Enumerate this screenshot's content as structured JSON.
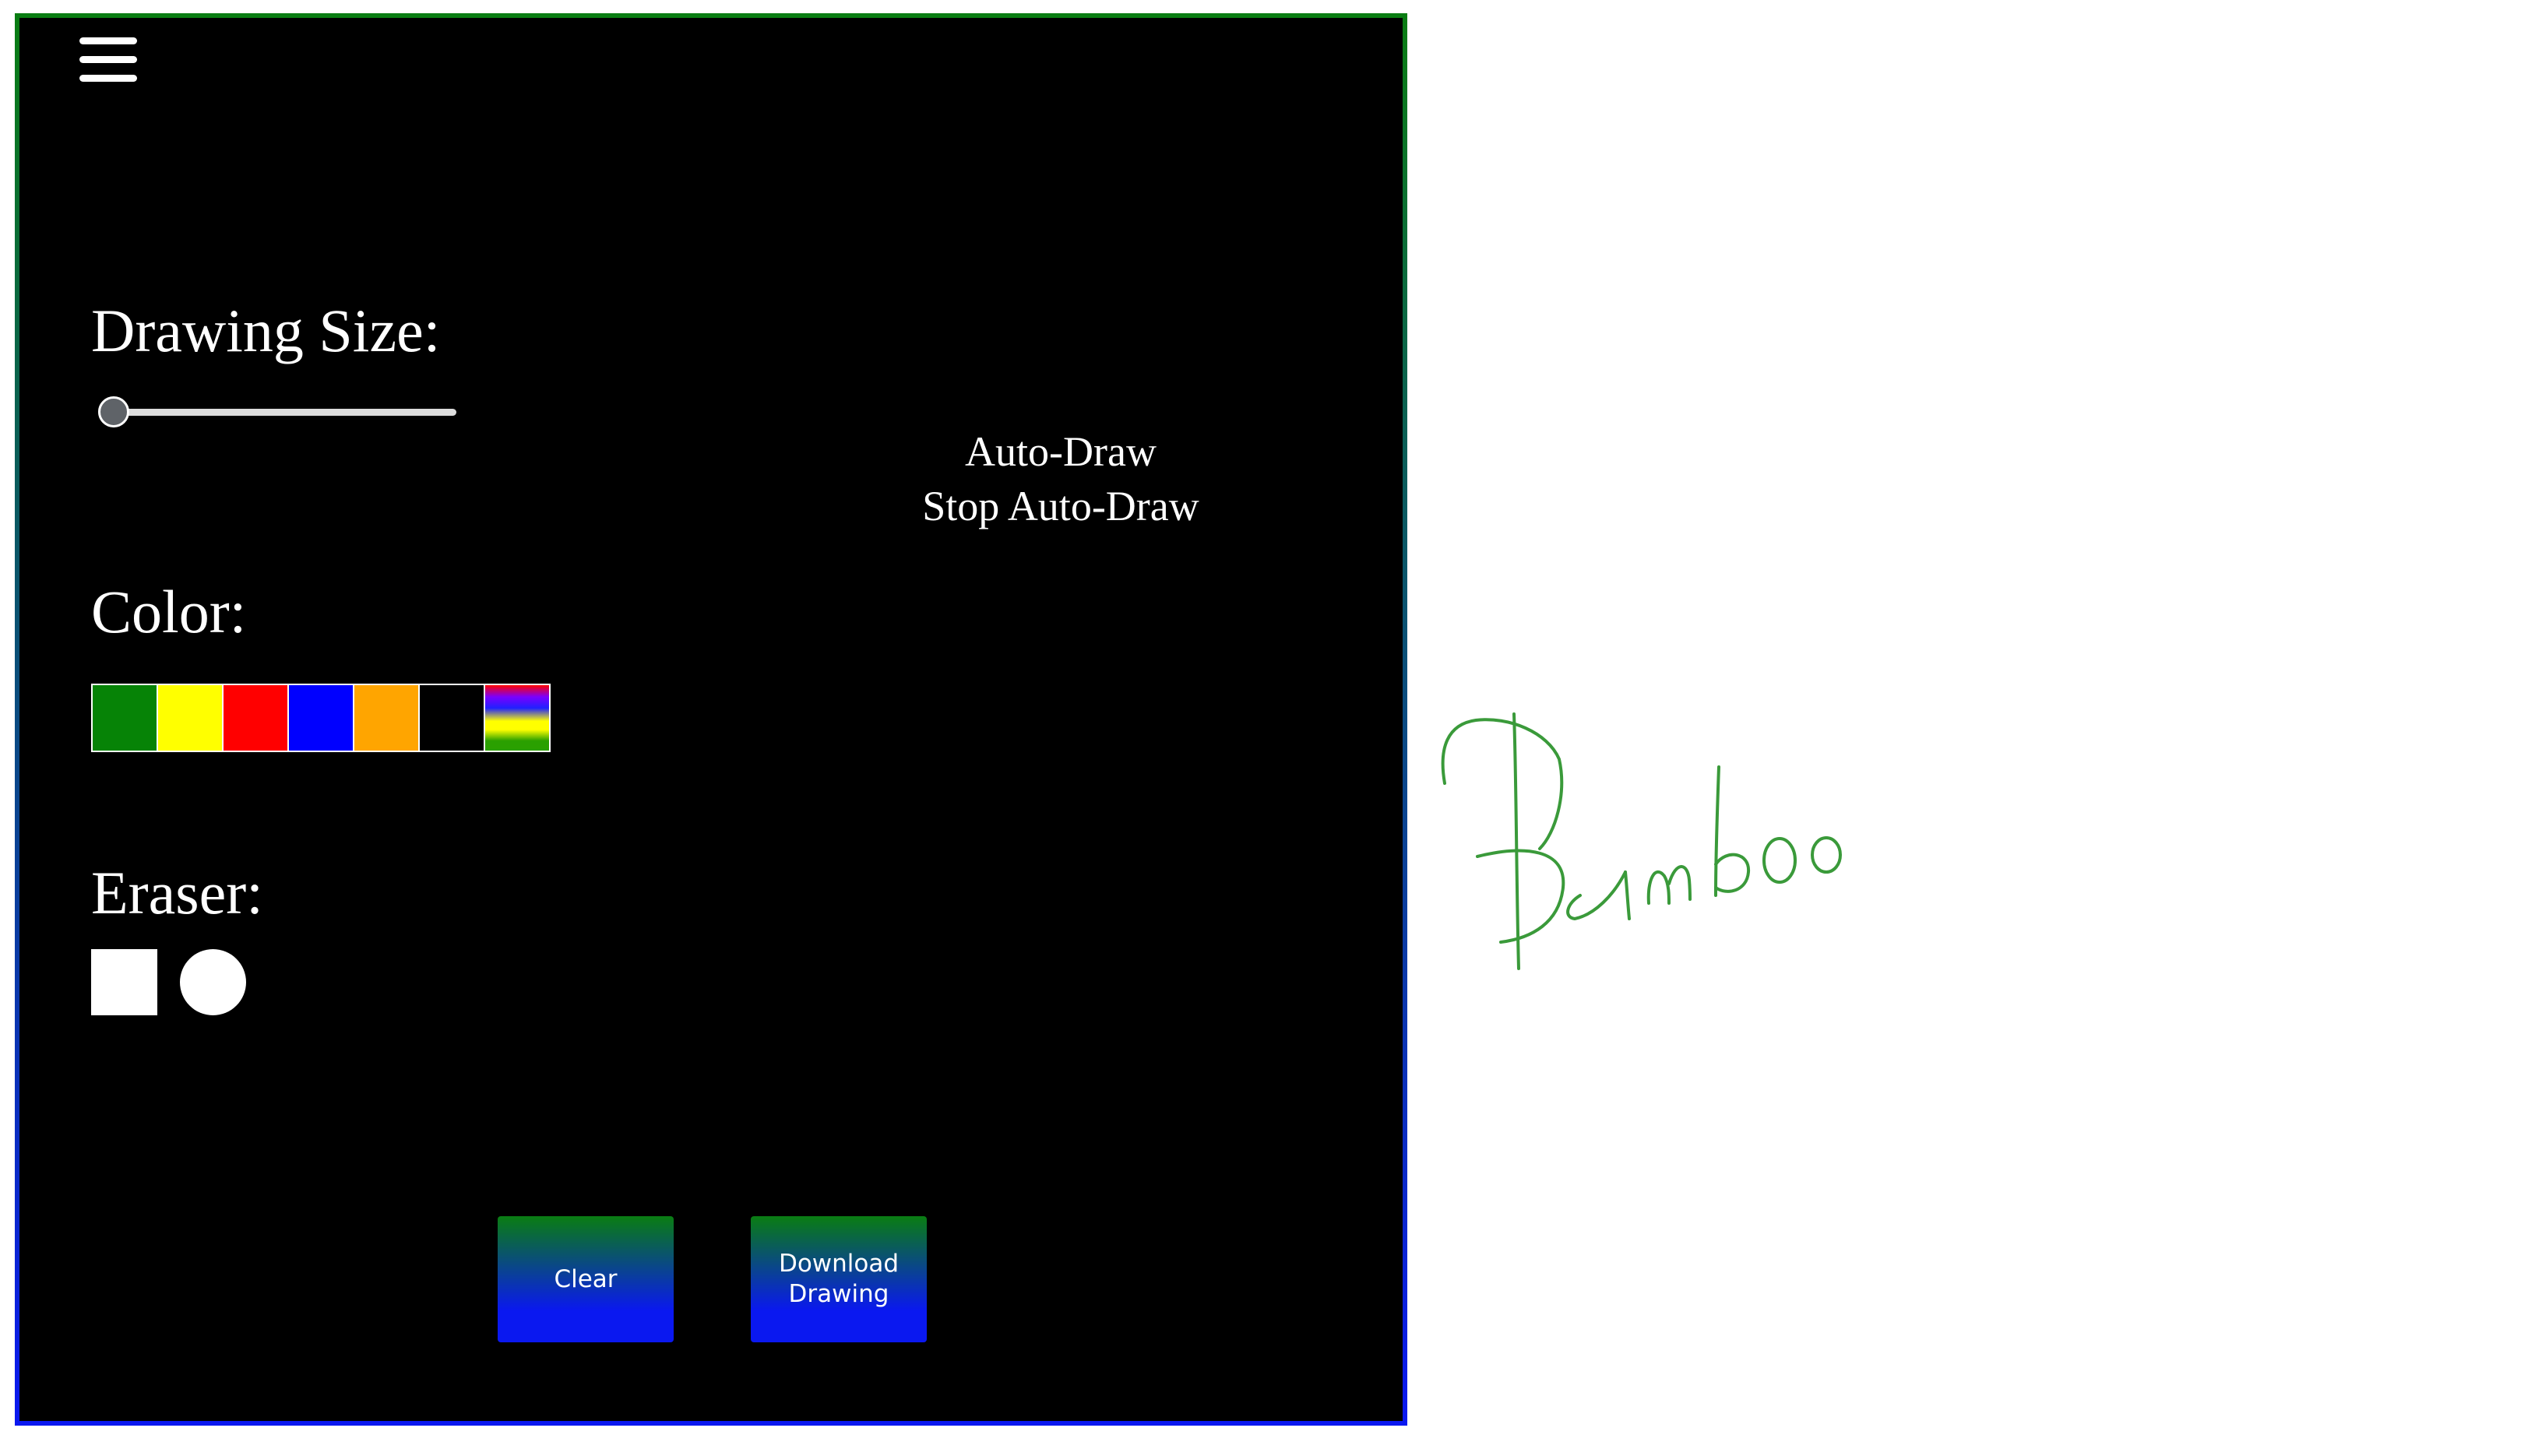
{
  "panel": {
    "menu_icon": "hamburger-menu-icon",
    "drawing_size_label": "Drawing Size:",
    "drawing_size_value": 0.0,
    "color_label": "Color:",
    "eraser_label": "Eraser:",
    "colors": [
      {
        "name": "green",
        "hex": "#068306"
      },
      {
        "name": "yellow",
        "hex": "#ffff00"
      },
      {
        "name": "red",
        "hex": "#ff0000"
      },
      {
        "name": "blue",
        "hex": "#0000ff"
      },
      {
        "name": "orange",
        "hex": "#ffa500"
      },
      {
        "name": "black",
        "hex": "#000000"
      },
      {
        "name": "rainbow",
        "hex": "rainbow-gradient"
      }
    ],
    "eraser_shapes": [
      "square",
      "circle"
    ],
    "auto_draw_label": "Auto-Draw",
    "stop_auto_draw_label": "Stop Auto-Draw",
    "clear_label": "Clear",
    "download_label_line1": "Download",
    "download_label_line2": "Drawing",
    "accent_top": "#0a7d12",
    "accent_bottom": "#0a18f0"
  },
  "canvas": {
    "stroke_color": "#3a9a3a",
    "handwritten_text": "Bamboo"
  }
}
